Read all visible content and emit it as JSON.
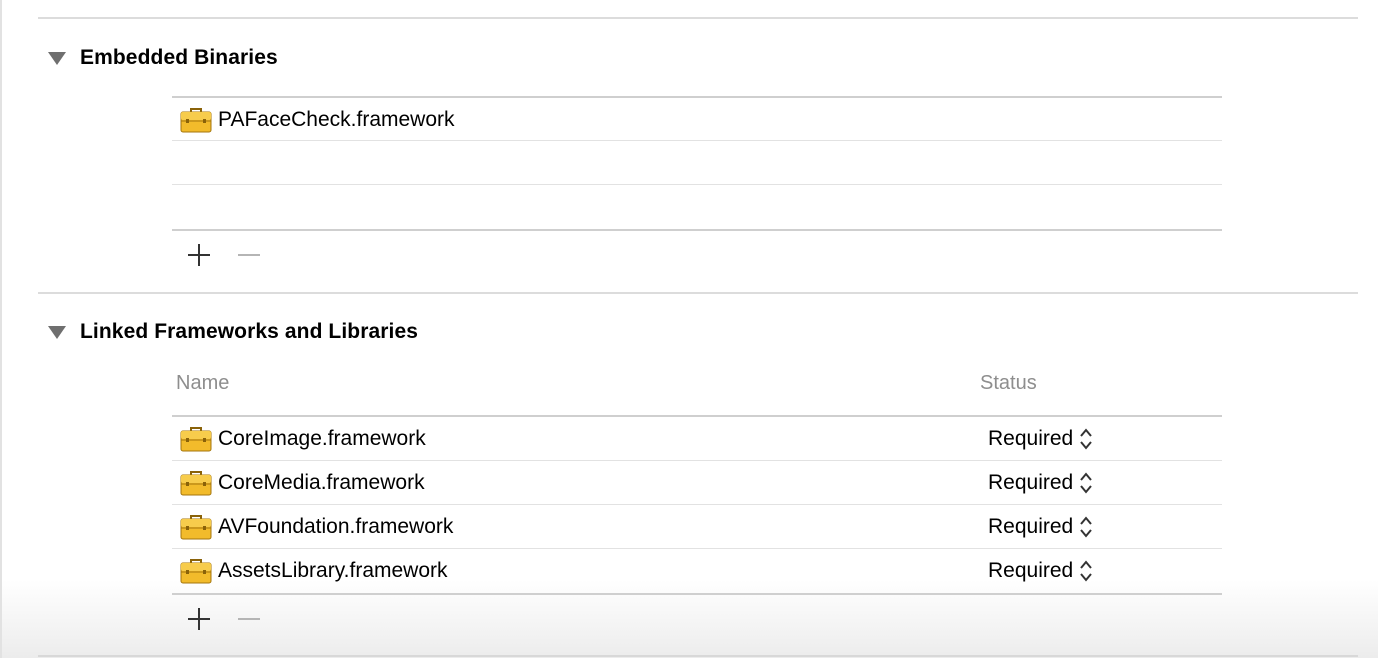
{
  "embedded_binaries": {
    "title": "Embedded Binaries",
    "items": [
      {
        "name": "PAFaceCheck.framework"
      }
    ]
  },
  "linked_frameworks": {
    "title": "Linked Frameworks and Libraries",
    "columns": {
      "name": "Name",
      "status": "Status"
    },
    "rows": [
      {
        "name": "CoreImage.framework",
        "status": "Required"
      },
      {
        "name": "CoreMedia.framework",
        "status": "Required"
      },
      {
        "name": "AVFoundation.framework",
        "status": "Required"
      },
      {
        "name": "AssetsLibrary.framework",
        "status": "Required"
      }
    ]
  },
  "icons": {
    "framework": "toolbox-icon",
    "add": "plus-icon",
    "remove": "minus-icon",
    "stepper": "up-down-chevron-icon",
    "disclosure": "disclosure-triangle-icon"
  },
  "colors": {
    "toolbox_fill": "#f2bb2b",
    "toolbox_stroke": "#a4760d",
    "separator": "#dcdcdc",
    "column_header": "#8e8e8e"
  }
}
